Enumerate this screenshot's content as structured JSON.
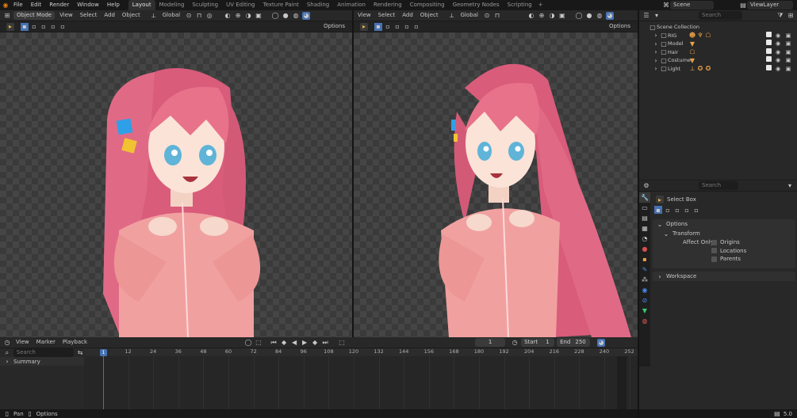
{
  "topbar": {
    "menu": [
      "File",
      "Edit",
      "Render",
      "Window",
      "Help"
    ],
    "workspaces": [
      "Layout",
      "Modeling",
      "Sculpting",
      "UV Editing",
      "Texture Paint",
      "Shading",
      "Animation",
      "Rendering",
      "Compositing",
      "Geometry Nodes",
      "Scripting"
    ],
    "active_workspace": "Layout",
    "add_tab": "+",
    "scene": "Scene",
    "view_layer": "ViewLayer"
  },
  "viewport_left": {
    "mode": "Object Mode",
    "menu": [
      "View",
      "Select",
      "Add",
      "Object"
    ],
    "orientation": "Global",
    "options_label": "Options"
  },
  "viewport_right": {
    "menu": [
      "View",
      "Select",
      "Add",
      "Object"
    ],
    "orientation": "Global",
    "options_label": "Options"
  },
  "outliner": {
    "search_placeholder": "Search",
    "root": "Scene Collection",
    "items": [
      {
        "label": "RIG"
      },
      {
        "label": "Model"
      },
      {
        "label": "Hair"
      },
      {
        "label": "Costume"
      },
      {
        "label": "Light"
      }
    ]
  },
  "properties": {
    "search_placeholder": "Search",
    "tool_name": "Select Box",
    "options_panel": "Options",
    "transform_panel": "Transform",
    "affect_only_label": "Affect Only",
    "affect_items": [
      "Origins",
      "Locations",
      "Parents"
    ],
    "workspace_panel": "Workspace"
  },
  "timeline": {
    "menu": [
      "View",
      "Marker",
      "Playback"
    ],
    "current_frame": "1",
    "start_label": "Start",
    "start_value": "1",
    "end_label": "End",
    "end_value": "250",
    "search_placeholder": "Search",
    "summary_label": "Summary",
    "frame_marker": "1",
    "ruler": [
      "12",
      "24",
      "36",
      "48",
      "60",
      "72",
      "84",
      "96",
      "108",
      "120",
      "132",
      "144",
      "156",
      "168",
      "180",
      "192",
      "204",
      "216",
      "228",
      "240",
      "252"
    ]
  },
  "statusbar": {
    "left1": "Pan",
    "left2": "Options",
    "version": "5.0"
  },
  "colors": {
    "accent": "#4772b3",
    "hair": "#e8728a",
    "jacket": "#f1a0a0"
  }
}
